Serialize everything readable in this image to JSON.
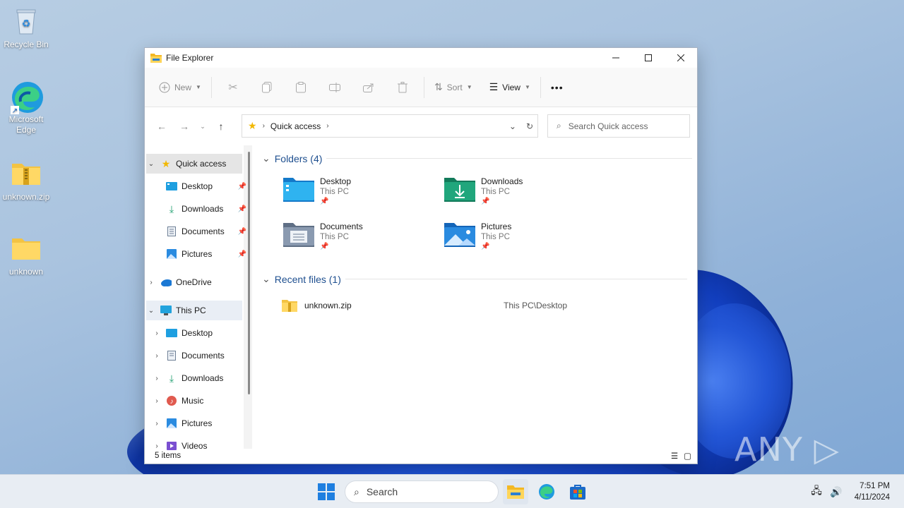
{
  "desktop": {
    "icons": [
      {
        "label": "Recycle Bin"
      },
      {
        "label": "Microsoft Edge"
      },
      {
        "label": "unknown.zip"
      },
      {
        "label": "unknown"
      }
    ]
  },
  "window": {
    "title": "File Explorer",
    "toolbar": {
      "new_label": "New",
      "sort_label": "Sort",
      "view_label": "View",
      "more_label": "•••"
    },
    "address": {
      "location": "Quick access",
      "search_placeholder": "Search Quick access"
    },
    "sidebar": {
      "items": [
        {
          "label": "Quick access"
        },
        {
          "label": "Desktop"
        },
        {
          "label": "Downloads"
        },
        {
          "label": "Documents"
        },
        {
          "label": "Pictures"
        },
        {
          "label": "OneDrive"
        },
        {
          "label": "This PC"
        },
        {
          "label": "Desktop"
        },
        {
          "label": "Documents"
        },
        {
          "label": "Downloads"
        },
        {
          "label": "Music"
        },
        {
          "label": "Pictures"
        },
        {
          "label": "Videos"
        }
      ]
    },
    "content": {
      "folders_header": "Folders (4)",
      "folders": [
        {
          "name": "Desktop",
          "location": "This PC"
        },
        {
          "name": "Downloads",
          "location": "This PC"
        },
        {
          "name": "Documents",
          "location": "This PC"
        },
        {
          "name": "Pictures",
          "location": "This PC"
        }
      ],
      "recent_header": "Recent files (1)",
      "recent": [
        {
          "name": "unknown.zip",
          "path": "This PC\\Desktop"
        }
      ]
    },
    "status": {
      "item_count": "5 items"
    }
  },
  "taskbar": {
    "search_label": "Search",
    "time": "7:51 PM",
    "date": "4/11/2024"
  },
  "watermark": "ANY ▷ RUN"
}
